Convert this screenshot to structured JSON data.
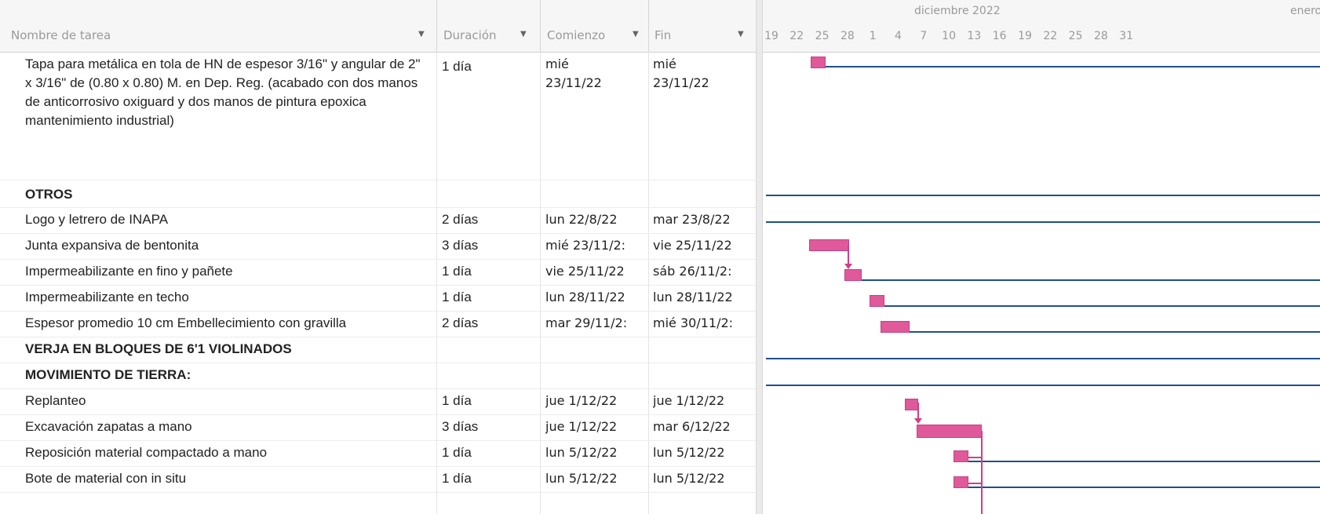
{
  "header": {
    "task_name": "Nombre de tarea",
    "duration": "Duración",
    "start": "Comienzo",
    "finish": "Fin",
    "month_dec": "diciembre 2022",
    "month_jan": "enero",
    "ticks": [
      "19",
      "22",
      "25",
      "28",
      "1",
      "4",
      "7",
      "10",
      "13",
      "16",
      "19",
      "22",
      "25",
      "28",
      "31"
    ]
  },
  "rows": [
    {
      "name": "Tapa para metálica en tola de HN de espesor 3/16\" y angular de 2\" x 3/16\" de (0.80 x 0.80) M. en Dep. Reg. (acabado con dos manos de anticorrosivo oxiguard y dos manos de pintura epoxica mantenimiento industrial)",
      "duration": "1 día",
      "start": "mié 23/11/22",
      "finish": "mié 23/11/22",
      "summary": false
    },
    {
      "name": "OTROS",
      "duration": "",
      "start": "",
      "finish": "",
      "summary": true
    },
    {
      "name": "Logo y letrero de INAPA",
      "duration": "2 días",
      "start": "lun 22/8/22",
      "finish": "mar 23/8/22",
      "summary": false
    },
    {
      "name": "Junta expansiva de bentonita",
      "duration": "3 días",
      "start": "mié 23/11/2:",
      "finish": "vie 25/11/22",
      "summary": false
    },
    {
      "name": "Impermeabilizante en fino y pañete",
      "duration": "1 día",
      "start": "vie 25/11/22",
      "finish": "sáb 26/11/2:",
      "summary": false
    },
    {
      "name": "Impermeabilizante en techo",
      "duration": "1 día",
      "start": "lun 28/11/22",
      "finish": "lun 28/11/22",
      "summary": false
    },
    {
      "name": "Espesor promedio 10 cm Embellecimiento con gravilla",
      "duration": "2 días",
      "start": "mar 29/11/2:",
      "finish": "mié 30/11/2:",
      "summary": false
    },
    {
      "name": "VERJA EN BLOQUES DE 6'1 VIOLINADOS",
      "duration": "",
      "start": "",
      "finish": "",
      "summary": true
    },
    {
      "name": "MOVIMIENTO DE TIERRA:",
      "duration": "",
      "start": "",
      "finish": "",
      "summary": true
    },
    {
      "name": "Replanteo",
      "duration": "1 día",
      "start": "jue 1/12/22",
      "finish": "jue 1/12/22",
      "summary": false
    },
    {
      "name": "Excavación zapatas a mano",
      "duration": "3 días",
      "start": "jue 1/12/22",
      "finish": "mar 6/12/22",
      "summary": false
    },
    {
      "name": "Reposición material compactado a mano",
      "duration": "1 día",
      "start": "lun 5/12/22",
      "finish": "lun 5/12/22",
      "summary": false
    },
    {
      "name": "Bote de material con in situ",
      "duration": "1 día",
      "start": "lun 5/12/22",
      "finish": "lun 5/12/22",
      "summary": false
    }
  ],
  "colors": {
    "bar": "#e05a9b",
    "summary_line": "#1f4f8f",
    "link": "#d23d86"
  }
}
